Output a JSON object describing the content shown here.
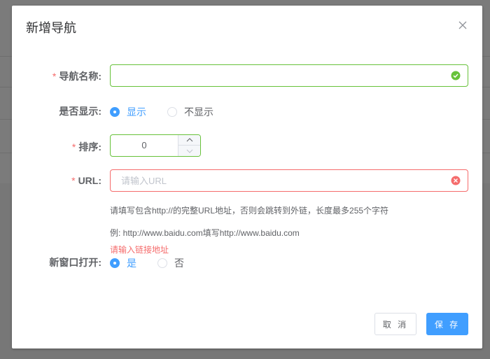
{
  "dialog": {
    "title": "新增导航",
    "close_icon": "close-icon"
  },
  "form": {
    "name": {
      "label": "导航名称:",
      "required_mark": "*",
      "value": "",
      "status_icon": "check-circle-icon"
    },
    "show": {
      "label": "是否显示:",
      "options": [
        "显示",
        "不显示"
      ],
      "selected": "显示"
    },
    "order": {
      "label": "排序:",
      "required_mark": "*",
      "value": "0"
    },
    "url": {
      "label": "URL:",
      "required_mark": "*",
      "value": "",
      "placeholder": "请输入URL",
      "status_icon": "error-circle-icon",
      "hint1": "请填写包含http://的完整URL地址，否则会跳转到外链，长度最多255个字符",
      "hint2": "例: http://www.baidu.com填写http://www.baidu.com",
      "error": "请输入链接地址"
    },
    "new_window": {
      "label": "新窗口打开:",
      "options": [
        "是",
        "否"
      ],
      "selected": "是"
    }
  },
  "footer": {
    "cancel_label": "取 消",
    "save_label": "保 存"
  },
  "colors": {
    "primary": "#409eff",
    "success": "#67c23a",
    "danger": "#f56c6c"
  }
}
